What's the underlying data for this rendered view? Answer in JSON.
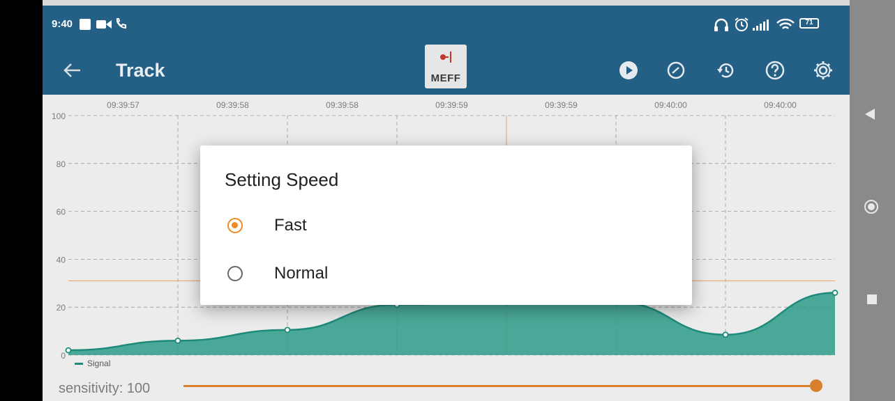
{
  "status_bar": {
    "time": "9:40",
    "battery": "71"
  },
  "app_bar": {
    "title": "Track",
    "logo_text": "MEFF"
  },
  "chart_data": {
    "type": "area",
    "x": [
      "09:39:57",
      "09:39:58",
      "09:39:58",
      "09:39:59",
      "09:39:59",
      "09:40:00",
      "09:40:00"
    ],
    "ytick_labels": [
      "100",
      "80",
      "60",
      "40",
      "20",
      "0"
    ],
    "ylim": [
      0,
      100
    ],
    "reference_line": 31,
    "series": [
      {
        "name": "Signal",
        "values": [
          2,
          6,
          10.5,
          21,
          22,
          22,
          8.5,
          26
        ]
      }
    ],
    "grid": true,
    "legend": "bottom-left",
    "colors": {
      "line": "#1e8a7a",
      "fill": "#2e9c89",
      "reference": "#e7a25f"
    }
  },
  "sensitivity": {
    "label": "sensitivity:",
    "value": "100",
    "fill_fraction": 1.0
  },
  "dialog": {
    "title": "Setting Speed",
    "options": [
      {
        "label": "Fast",
        "selected": true
      },
      {
        "label": "Normal",
        "selected": false
      }
    ]
  },
  "colors": {
    "app_bar": "#245f85",
    "accent": "#f08a24",
    "slider": "#d9802f"
  }
}
